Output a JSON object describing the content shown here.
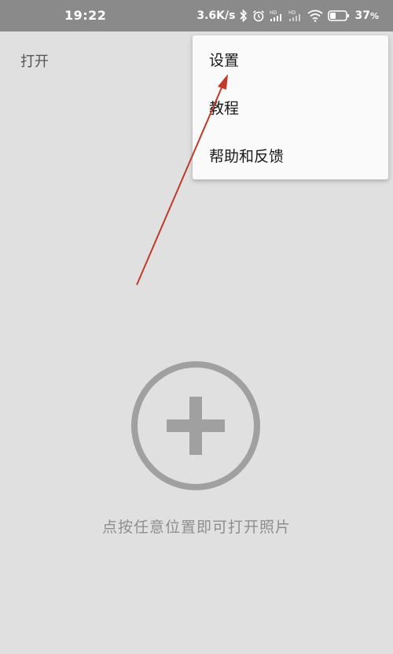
{
  "status_bar": {
    "time": "19:22",
    "network_speed": "3.6K/s",
    "battery_percent": "37",
    "battery_percent_sign": "%",
    "battery_level": 0.37,
    "icons": [
      "bluetooth-icon",
      "alarm-icon",
      "hd-signal-icon",
      "hd-signal-icon",
      "wifi-icon",
      "battery-icon"
    ]
  },
  "toolbar": {
    "open_label": "打开"
  },
  "menu": {
    "items": [
      {
        "label": "设置"
      },
      {
        "label": "教程"
      },
      {
        "label": "帮助和反馈"
      }
    ]
  },
  "main": {
    "add_icon": "add-circle-icon",
    "hint": "点按任意位置即可打开照片"
  },
  "colors": {
    "background": "#e0e0e0",
    "status_bar": "#8a8a8a",
    "menu_background": "#fafafa",
    "add_icon": "#a0a0a0",
    "hint_text": "#8e8e8e",
    "annotation_arrow": "#c0392b"
  }
}
